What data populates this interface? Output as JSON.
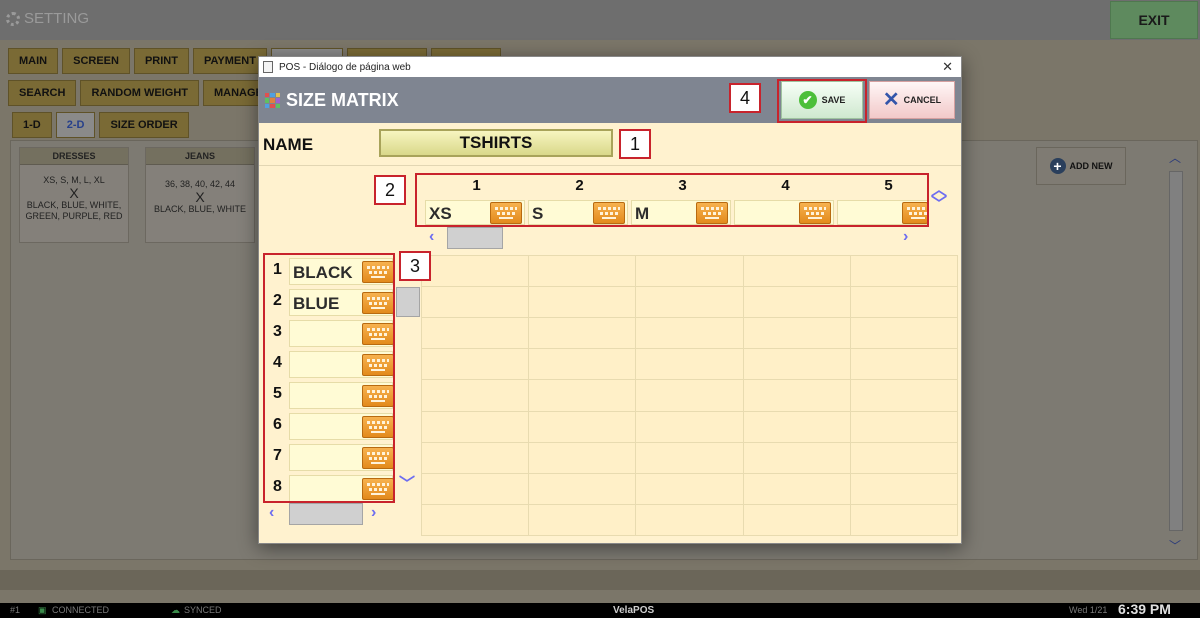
{
  "app": {
    "title": "SETTING",
    "exit_label": "EXIT"
  },
  "tabs_row1": [
    "MAIN",
    "SCREEN",
    "PRINT",
    "PAYMENT"
  ],
  "tabs_row2": [
    "SEARCH",
    "RANDOM WEIGHT",
    "MANAGE"
  ],
  "tabs_row3": [
    "1-D",
    "2-D",
    "SIZE ORDER"
  ],
  "categories": [
    {
      "name": "DRESSES",
      "sizes": "XS, S, M, L, XL",
      "x": "X",
      "colors": "BLACK, BLUE, WHITE, GREEN, PURPLE, RED"
    },
    {
      "name": "JEANS",
      "sizes": "36, 38, 40, 42, 44",
      "x": "X",
      "colors": "BLACK, BLUE, WHITE"
    }
  ],
  "add_new_label": "ADD NEW",
  "dialog": {
    "window_title": "POS - Diálogo de página web",
    "close_glyph": "✕",
    "header_title": "SIZE MATRIX",
    "save_label": "SAVE",
    "cancel_label": "CANCEL",
    "name_label": "NAME",
    "name_value": "TSHIRTS",
    "columns": [
      {
        "num": "1",
        "value": "XS"
      },
      {
        "num": "2",
        "value": "S"
      },
      {
        "num": "3",
        "value": "M"
      },
      {
        "num": "4",
        "value": ""
      },
      {
        "num": "5",
        "value": ""
      }
    ],
    "rows": [
      {
        "num": "1",
        "value": "BLACK"
      },
      {
        "num": "2",
        "value": "BLUE"
      },
      {
        "num": "3",
        "value": ""
      },
      {
        "num": "4",
        "value": ""
      },
      {
        "num": "5",
        "value": ""
      },
      {
        "num": "6",
        "value": ""
      },
      {
        "num": "7",
        "value": ""
      },
      {
        "num": "8",
        "value": ""
      }
    ]
  },
  "callouts": [
    "1",
    "2",
    "3",
    "4"
  ],
  "status": {
    "station": "#1",
    "connection": "CONNECTED",
    "sync": "SYNCED",
    "brand": "VelaPOS",
    "date": "Wed 1/21",
    "time": "6:39 PM"
  },
  "colors": {
    "dialog_bg": "#fff2cf",
    "header_bg": "#7f8591",
    "keyboard_orange": "#e38a1c",
    "callout_red": "#c8232c",
    "save_green": "#4cbf3a",
    "cancel_blue": "#3355aa"
  }
}
